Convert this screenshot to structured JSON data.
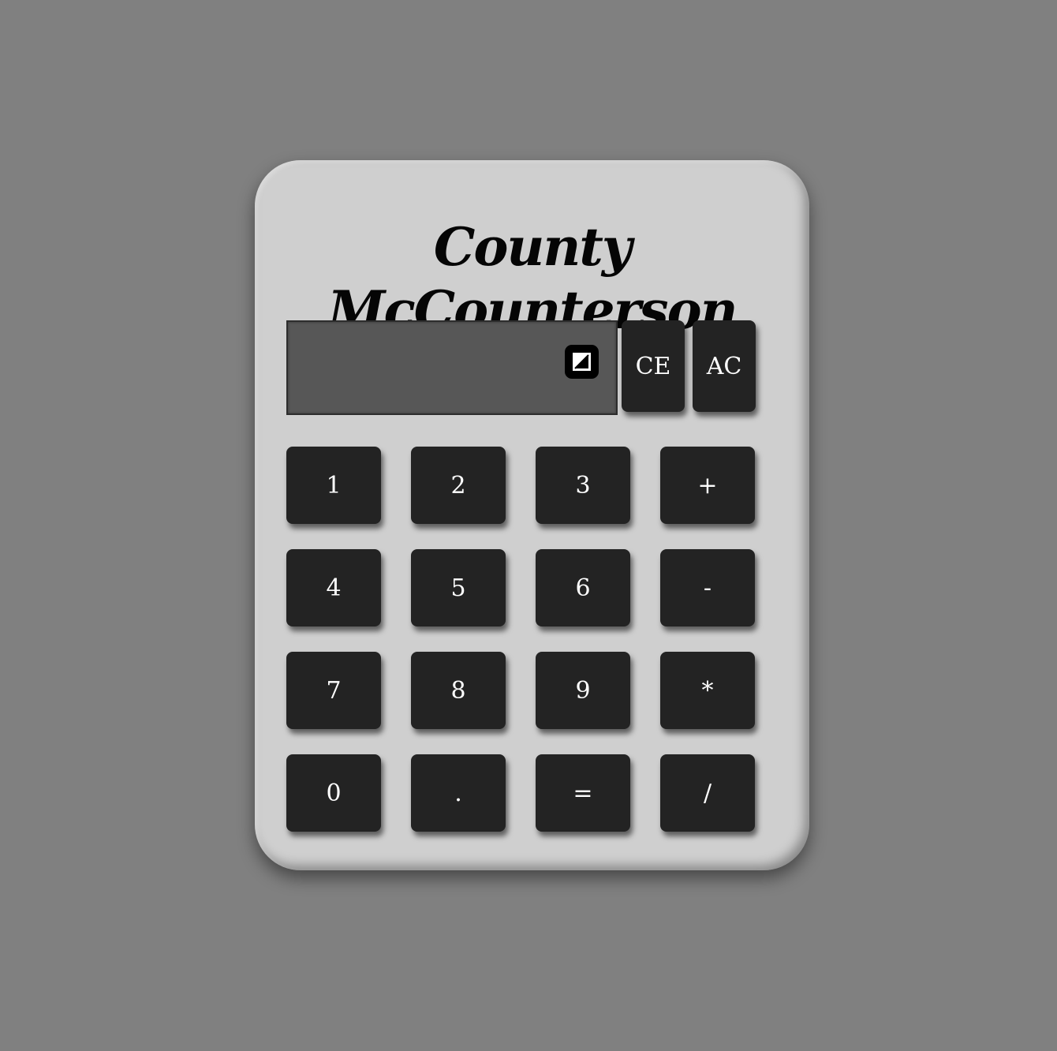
{
  "calculator": {
    "title": "County McCounterson",
    "display": {
      "value": ""
    },
    "clear_entry_label": "CE",
    "all_clear_label": "AC"
  },
  "keypad": {
    "rows": [
      [
        "1",
        "2",
        "3",
        "+"
      ],
      [
        "4",
        "5",
        "6",
        "-"
      ],
      [
        "7",
        "8",
        "9",
        "*"
      ],
      [
        "0",
        ".",
        "=",
        "/"
      ]
    ]
  },
  "colors": {
    "background": "#808080",
    "body": "#cfcfcf",
    "display": "#575757",
    "button": "#232323",
    "button_text": "#ffffff",
    "title_text": "#050505"
  },
  "icons": {
    "display_icon": "broken-image-icon"
  }
}
